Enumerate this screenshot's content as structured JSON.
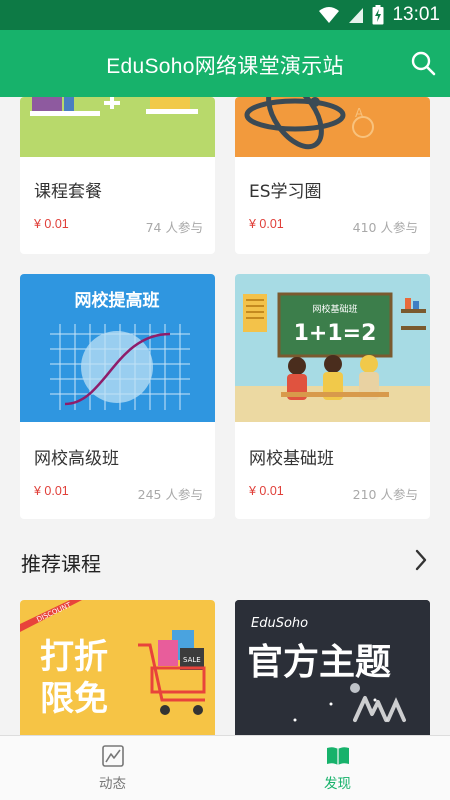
{
  "status_bar": {
    "time": "13:01"
  },
  "app_bar": {
    "title": "EduSoho网络课堂演示站"
  },
  "courses": [
    {
      "title": "课程套餐",
      "price": "¥ 0.01",
      "participants": "74 人参与"
    },
    {
      "title": "ES学习圈",
      "price": "¥ 0.01",
      "participants": "410 人参与"
    },
    {
      "title": "网校高级班",
      "price": "¥ 0.01",
      "participants": "245 人参与",
      "cover_text": "网校提高班"
    },
    {
      "title": "网校基础班",
      "price": "¥ 0.01",
      "participants": "210 人参与",
      "cover_text": "网校基础班",
      "board_text": "1+1=2"
    }
  ],
  "recommended": {
    "section_title": "推荐课程",
    "cards": [
      {
        "badge": "DISCOUNT",
        "line1": "打折",
        "line2": "限免",
        "tag": "SALE"
      },
      {
        "brand": "EduSoho",
        "headline": "官方主题"
      }
    ]
  },
  "bottom_nav": [
    {
      "label": "动态",
      "icon": "chart-icon",
      "active": false
    },
    {
      "label": "发现",
      "icon": "book-icon",
      "active": true
    }
  ],
  "colors": {
    "primary": "#17b26b",
    "status_bar": "#0d7a45",
    "price": "#e0403a"
  }
}
